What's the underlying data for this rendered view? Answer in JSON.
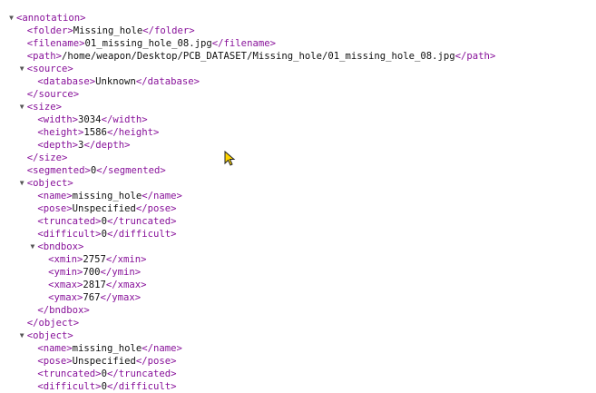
{
  "toggle_glyph": "▼",
  "lines": [
    {
      "indent": 0,
      "toggle": true,
      "open": "<annotation>"
    },
    {
      "indent": 1,
      "open": "<folder>",
      "text": "Missing_hole",
      "close": "</folder>"
    },
    {
      "indent": 1,
      "open": "<filename>",
      "text": "01_missing_hole_08.jpg",
      "close": "</filename>"
    },
    {
      "indent": 1,
      "open": "<path>",
      "text": "/home/weapon/Desktop/PCB_DATASET/Missing_hole/01_missing_hole_08.jpg",
      "close": "</path>"
    },
    {
      "indent": 1,
      "toggle": true,
      "open": "<source>"
    },
    {
      "indent": 2,
      "open": "<database>",
      "text": "Unknown",
      "close": "</database>"
    },
    {
      "indent": 1,
      "close": "</source>"
    },
    {
      "indent": 1,
      "toggle": true,
      "open": "<size>"
    },
    {
      "indent": 2,
      "open": "<width>",
      "text": "3034",
      "close": "</width>"
    },
    {
      "indent": 2,
      "open": "<height>",
      "text": "1586",
      "close": "</height>"
    },
    {
      "indent": 2,
      "open": "<depth>",
      "text": "3",
      "close": "</depth>"
    },
    {
      "indent": 1,
      "close": "</size>"
    },
    {
      "indent": 1,
      "open": "<segmented>",
      "text": "0",
      "close": "</segmented>"
    },
    {
      "indent": 1,
      "toggle": true,
      "open": "<object>"
    },
    {
      "indent": 2,
      "open": "<name>",
      "text": "missing_hole",
      "close": "</name>"
    },
    {
      "indent": 2,
      "open": "<pose>",
      "text": "Unspecified",
      "close": "</pose>"
    },
    {
      "indent": 2,
      "open": "<truncated>",
      "text": "0",
      "close": "</truncated>"
    },
    {
      "indent": 2,
      "open": "<difficult>",
      "text": "0",
      "close": "</difficult>"
    },
    {
      "indent": 2,
      "toggle": true,
      "open": "<bndbox>"
    },
    {
      "indent": 3,
      "open": "<xmin>",
      "text": "2757",
      "close": "</xmin>"
    },
    {
      "indent": 3,
      "open": "<ymin>",
      "text": "700",
      "close": "</ymin>"
    },
    {
      "indent": 3,
      "open": "<xmax>",
      "text": "2817",
      "close": "</xmax>"
    },
    {
      "indent": 3,
      "open": "<ymax>",
      "text": "767",
      "close": "</ymax>"
    },
    {
      "indent": 2,
      "close": "</bndbox>"
    },
    {
      "indent": 1,
      "close": "</object>"
    },
    {
      "indent": 1,
      "toggle": true,
      "open": "<object>"
    },
    {
      "indent": 2,
      "open": "<name>",
      "text": "missing_hole",
      "close": "</name>"
    },
    {
      "indent": 2,
      "open": "<pose>",
      "text": "Unspecified",
      "close": "</pose>"
    },
    {
      "indent": 2,
      "open": "<truncated>",
      "text": "0",
      "close": "</truncated>"
    },
    {
      "indent": 2,
      "open": "<difficult>",
      "text": "0",
      "close": "</difficult>"
    }
  ]
}
